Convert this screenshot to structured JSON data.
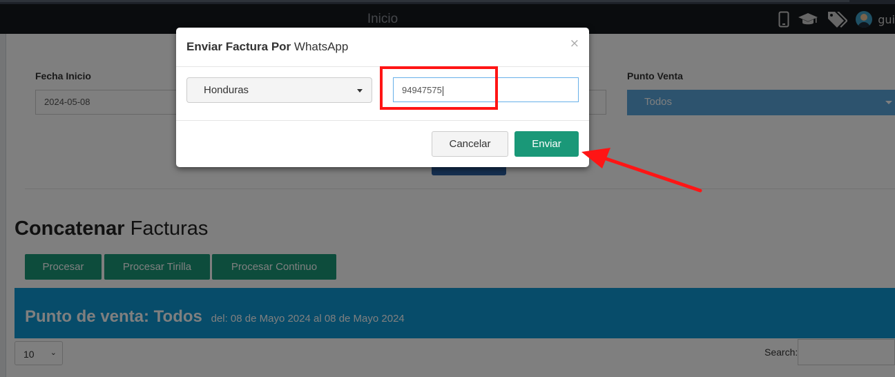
{
  "navbar": {
    "title": "Inicio",
    "user_name": "gui",
    "icons": [
      "mobile-icon",
      "graduation-cap-icon",
      "tags-icon",
      "user-avatar"
    ]
  },
  "filters": {
    "fecha_inicio_label": "Fecha Inicio",
    "fecha_inicio_value": "2024-05-08",
    "punto_venta_label": "Punto Venta",
    "punto_venta_value": "Todos"
  },
  "concatenar": {
    "title_bold": "Concatenar",
    "title_rest": "Facturas",
    "buttons": [
      "Procesar",
      "Procesar Tirilla",
      "Procesar Continuo"
    ]
  },
  "banner": {
    "title": "Punto de venta: Todos",
    "subtitle": "del: 08 de Mayo 2024 al 08 de Mayo 2024"
  },
  "table_controls": {
    "page_length": "10",
    "search_label": "Search:"
  },
  "modal": {
    "title_bold": "Enviar Factura Por",
    "title_rest": "WhatsApp",
    "close_symbol": "×",
    "country_value": "Honduras",
    "phone_value": "94947575",
    "cancel_label": "Cancelar",
    "send_label": "Enviar"
  },
  "colors": {
    "navbar": "#15181c",
    "primary_green": "#1a9878",
    "banner_blue": "#0f98d4",
    "select_blue": "#5aa6dd",
    "annotation_red": "#ff1515"
  }
}
